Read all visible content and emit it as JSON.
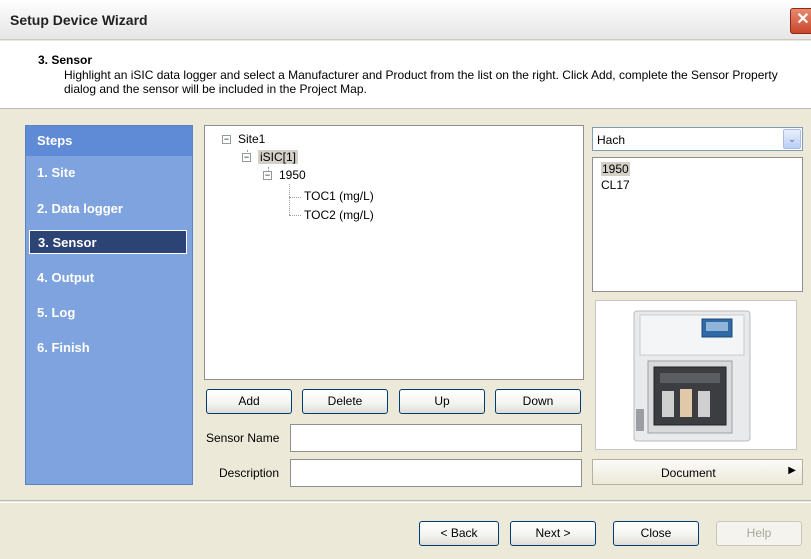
{
  "window": {
    "title": "Setup Device Wizard",
    "close_glyph": "✕"
  },
  "header": {
    "step_title": "3. Sensor",
    "description": "Highlight an iSIC data logger and select a Manufacturer and Product from the list on the right. Click Add, complete the Sensor Property dialog and the sensor will be included in the Project Map."
  },
  "steps": {
    "heading": "Steps",
    "items": [
      {
        "label": "1. Site"
      },
      {
        "label": "2. Data logger"
      },
      {
        "label": "3. Sensor",
        "active": true
      },
      {
        "label": "4. Output"
      },
      {
        "label": "5. Log"
      },
      {
        "label": "6. Finish"
      }
    ]
  },
  "tree": {
    "nodes": [
      {
        "label": "Site1",
        "expander": "⊟"
      },
      {
        "label": "iSIC[1]",
        "expander": "⊟",
        "selected": true
      },
      {
        "label": "1950",
        "expander": "⊟"
      },
      {
        "label": "TOC1 (mg/L)"
      },
      {
        "label": "TOC2 (mg/L)"
      }
    ]
  },
  "tree_buttons": {
    "add": "Add",
    "delete": "Delete",
    "up": "Up",
    "down": "Down"
  },
  "fields": {
    "sensor_name_label": "Sensor Name",
    "sensor_name_value": "",
    "description_label": "Description",
    "description_value": ""
  },
  "manufacturer": {
    "selected": "Hach",
    "arrow_glyph": "⌄"
  },
  "products": [
    {
      "label": "1950",
      "selected": true
    },
    {
      "label": "CL17"
    }
  ],
  "document_button": {
    "label": "Document",
    "arrow": "▶"
  },
  "footer": {
    "back": "< Back",
    "next": "Next >",
    "close": "Close",
    "help": "Help"
  },
  "colors": {
    "steps_panel_bg": "#7fa3df",
    "steps_header_bg": "#5f8ad6",
    "active_step_bg": "#2b4475",
    "button_border": "#003c74"
  }
}
